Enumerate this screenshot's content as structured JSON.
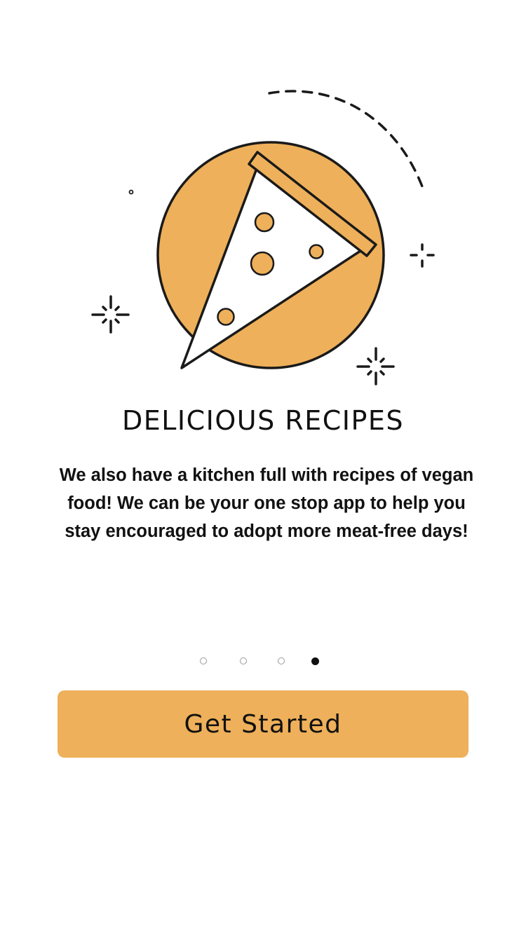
{
  "illustration": {
    "icon": "pizza-slice-icon",
    "accent_color": "#EEB05A",
    "stroke_color": "#1A1A1A"
  },
  "onboarding": {
    "title": "DELICIOUS RECIPES",
    "description": "We also have a kitchen full with recipes of vegan food! We can be your one stop app to help you stay encouraged to adopt more meat-free days!"
  },
  "pager": {
    "total_pages": 4,
    "current_page": 4
  },
  "cta": {
    "label": "Get Started",
    "color": "#EEB05A"
  }
}
